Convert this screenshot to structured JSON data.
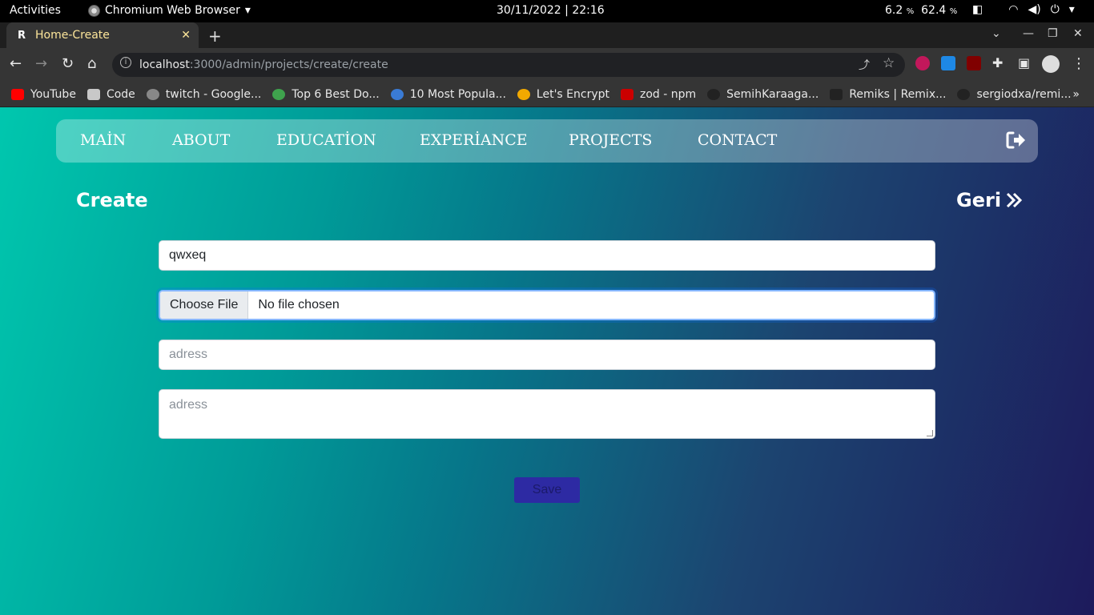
{
  "system": {
    "activities": "Activities",
    "app_name": "Chromium Web Browser",
    "date": "30/11/2022",
    "time": "22:16",
    "cpu": "6.2",
    "mem": "62.4",
    "percent": "%"
  },
  "browser": {
    "tab_title": "Home-Create",
    "url_host": "localhost",
    "url_path": ":3000/admin/projects/create/create",
    "bookmarks": [
      {
        "label": "YouTube",
        "color": "#ff0000"
      },
      {
        "label": "Code",
        "color": "#c8c8c8"
      },
      {
        "label": "twitch - Google...",
        "color": "#888888"
      },
      {
        "label": "Top 6 Best Do...",
        "color": "#3fa34d"
      },
      {
        "label": "10 Most Popula...",
        "color": "#3a7bd5"
      },
      {
        "label": "Let's Encrypt",
        "color": "#f2a900"
      },
      {
        "label": "zod - npm",
        "color": "#cb0000"
      },
      {
        "label": "SemihKaraaga...",
        "color": "#222222"
      },
      {
        "label": "Remiks | Remix...",
        "color": "#222222"
      },
      {
        "label": "sergiodxa/remi...",
        "color": "#222222"
      }
    ],
    "overflow": "»"
  },
  "navbar": {
    "items": [
      "MAİN",
      "ABOUT",
      "EDUCATİON",
      "EXPERİANCE",
      "PROJECTS",
      "CONTACT"
    ]
  },
  "page": {
    "heading": "Create",
    "back_label": "Geri",
    "title_value": "qwxeq",
    "choose_file": "Choose File",
    "no_file": "No file chosen",
    "address_placeholder": "adress",
    "textarea_placeholder": "adress",
    "save_label": "Save"
  },
  "colors": {
    "gradient_start": "#00c7ae",
    "gradient_end": "#1d1a5c",
    "save_button": "#2d2aa3"
  }
}
